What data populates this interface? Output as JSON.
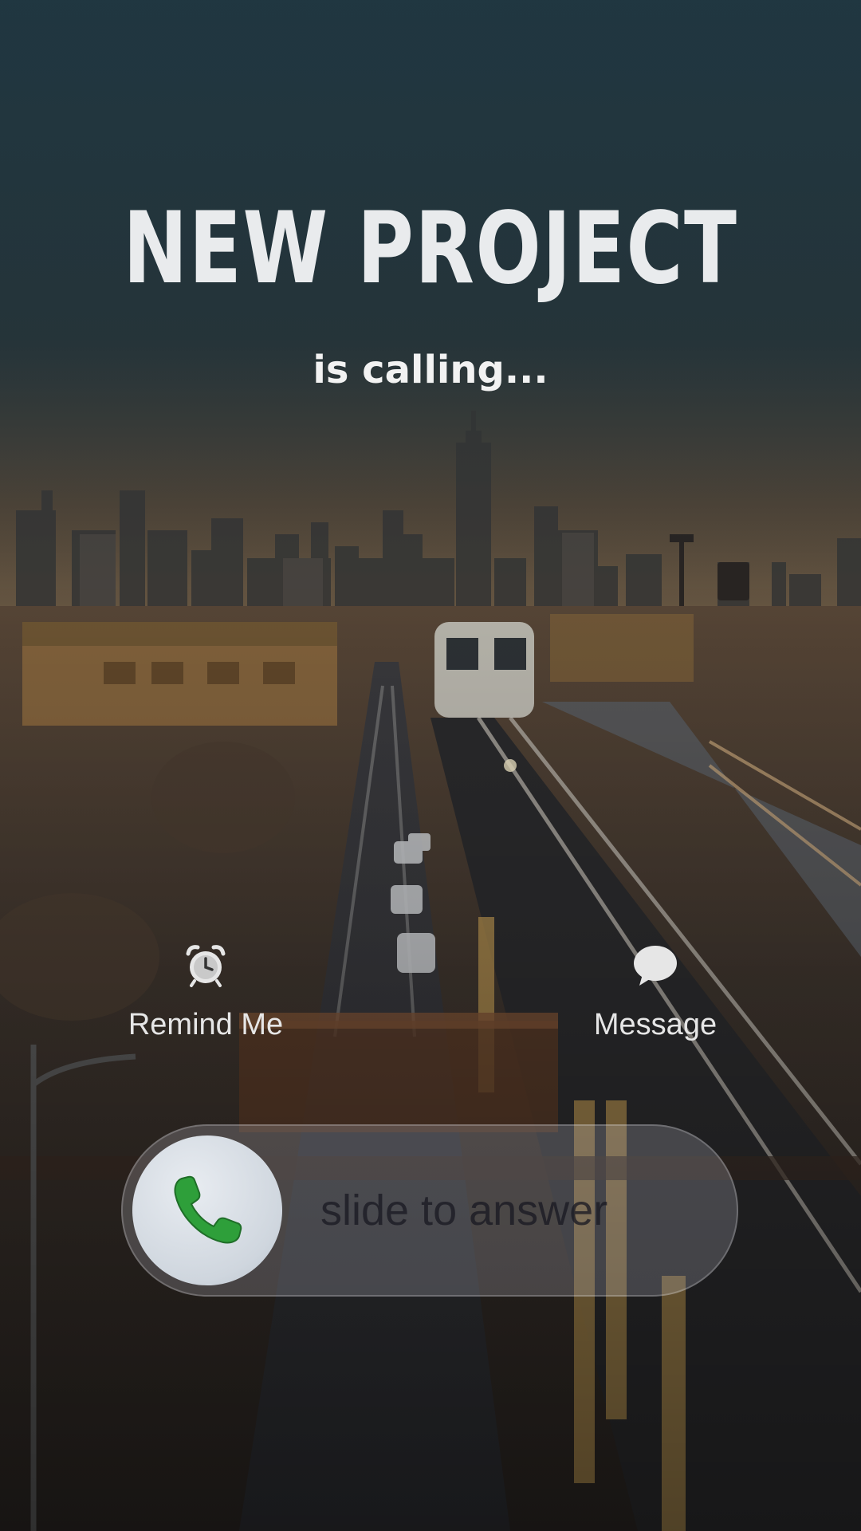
{
  "call": {
    "caller_name": "NEW PROJECT",
    "status_text": "is calling..."
  },
  "actions": {
    "remind": {
      "label": "Remind Me",
      "icon": "alarm-clock-icon"
    },
    "message": {
      "label": "Message",
      "icon": "speech-bubble-icon"
    }
  },
  "answer_slider": {
    "label": "slide to answer",
    "icon": "phone-icon",
    "accent_color": "#2e9f3a"
  }
}
